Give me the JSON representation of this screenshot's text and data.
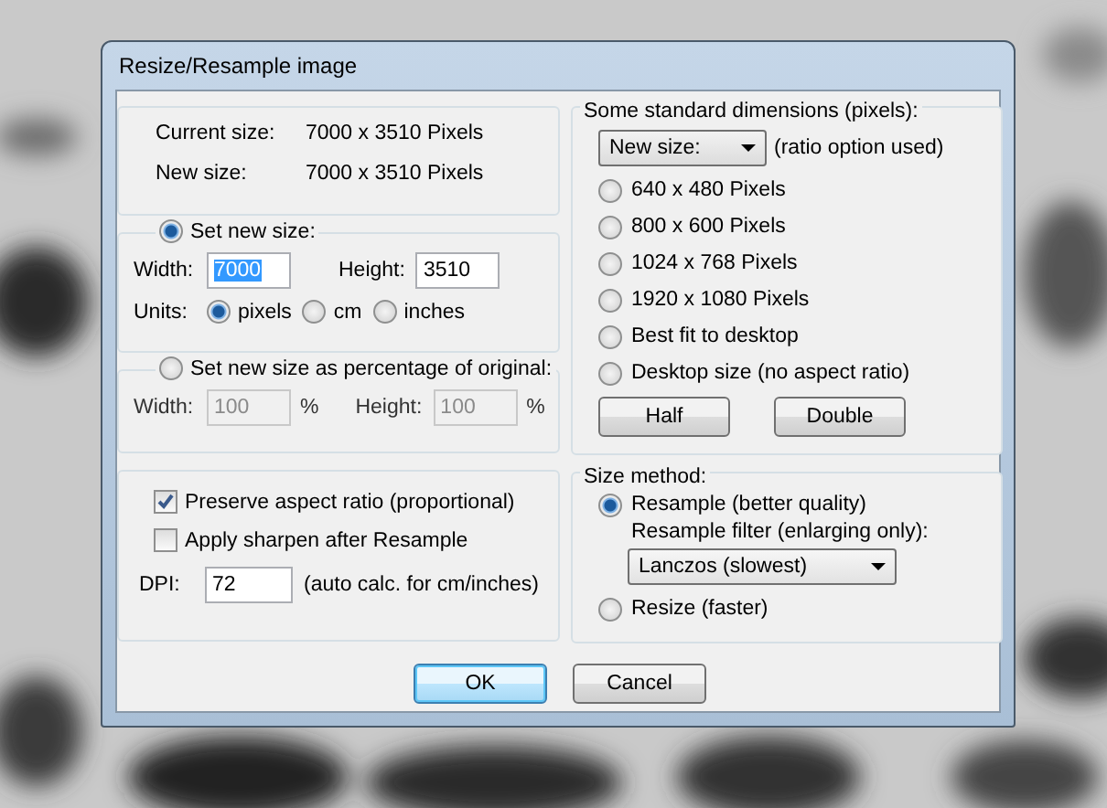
{
  "window": {
    "title": "Resize/Resample image"
  },
  "info": [
    {
      "label": "Current size:",
      "value": "7000  x  3510  Pixels"
    },
    {
      "label": "New size:",
      "value": "7000  x  3510  Pixels"
    }
  ],
  "set_new_size": {
    "label": "Set new size:",
    "selected": true,
    "width_label": "Width:",
    "width_value": "7000",
    "width_highlighted": true,
    "height_label": "Height:",
    "height_value": "3510",
    "units_label": "Units:",
    "units": [
      {
        "label": "pixels",
        "selected": true
      },
      {
        "label": "cm",
        "selected": false
      },
      {
        "label": "inches",
        "selected": false
      }
    ]
  },
  "percentage": {
    "label": "Set new size as percentage of original:",
    "selected": false,
    "disabled": true,
    "width_label": "Width:",
    "width_value": "100",
    "width_unit": "%",
    "height_label": "Height:",
    "height_value": "100",
    "height_unit": "%"
  },
  "options": {
    "checkboxes": [
      {
        "label": "Preserve aspect ratio (proportional)",
        "checked": true
      },
      {
        "label": "Apply sharpen after Resample",
        "checked": false
      }
    ],
    "dpi_label": "DPI:",
    "dpi_value": "72",
    "dpi_note": "(auto calc. for cm/inches)"
  },
  "standard_dimensions": {
    "title": "Some standard dimensions (pixels):",
    "dropdown": "New size:",
    "note": "(ratio option used)",
    "options": [
      {
        "label": "640 x 480 Pixels",
        "selected": false
      },
      {
        "label": "800 x 600 Pixels",
        "selected": false
      },
      {
        "label": "1024 x 768 Pixels",
        "selected": false
      },
      {
        "label": "1920 x 1080 Pixels",
        "selected": false
      },
      {
        "label": "Best fit to desktop",
        "selected": false
      },
      {
        "label": "Desktop size (no aspect ratio)",
        "selected": false
      }
    ],
    "buttons": [
      "Half",
      "Double"
    ]
  },
  "size_method": {
    "title": "Size method:",
    "resample": {
      "label": "Resample (better quality)",
      "selected": true
    },
    "filter_label": "Resample filter (enlarging only):",
    "filter_value": "Lanczos (slowest)",
    "resize": {
      "label": "Resize (faster)",
      "selected": false
    }
  },
  "buttons": [
    {
      "label": "OK",
      "default": true
    },
    {
      "label": "Cancel",
      "default": false
    }
  ]
}
